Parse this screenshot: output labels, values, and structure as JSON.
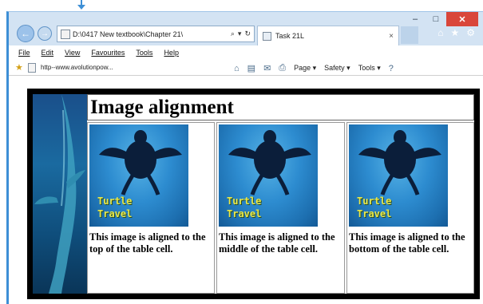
{
  "window": {
    "address": "D:\\0417 New textbook\\Chapter 21\\",
    "tab_title": "Task 21L",
    "min_glyph": "–",
    "max_glyph": "□",
    "close_glyph": "✕",
    "back_glyph": "←",
    "fwd_glyph": "→"
  },
  "menu": [
    "File",
    "Edit",
    "View",
    "Favourites",
    "Tools",
    "Help"
  ],
  "favorites": {
    "link": "http--www.avolutionpow..."
  },
  "commandbar": [
    "Page ▾",
    "Safety ▾",
    "Tools ▾"
  ],
  "page": {
    "heading": "Image alignment",
    "turtle_text_line1": "Turtle",
    "turtle_text_line2": "Travel",
    "cells": [
      {
        "caption": "This image is aligned to the top of the table cell."
      },
      {
        "caption": "This image is aligned to the middle of the table cell."
      },
      {
        "caption": "This image is aligned to the bottom of the table cell."
      }
    ]
  },
  "colors": {
    "frame": "#3d8fd6",
    "close": "#d9463a",
    "water": "#2d8cd0",
    "turtle_text": "#e8e84a"
  }
}
